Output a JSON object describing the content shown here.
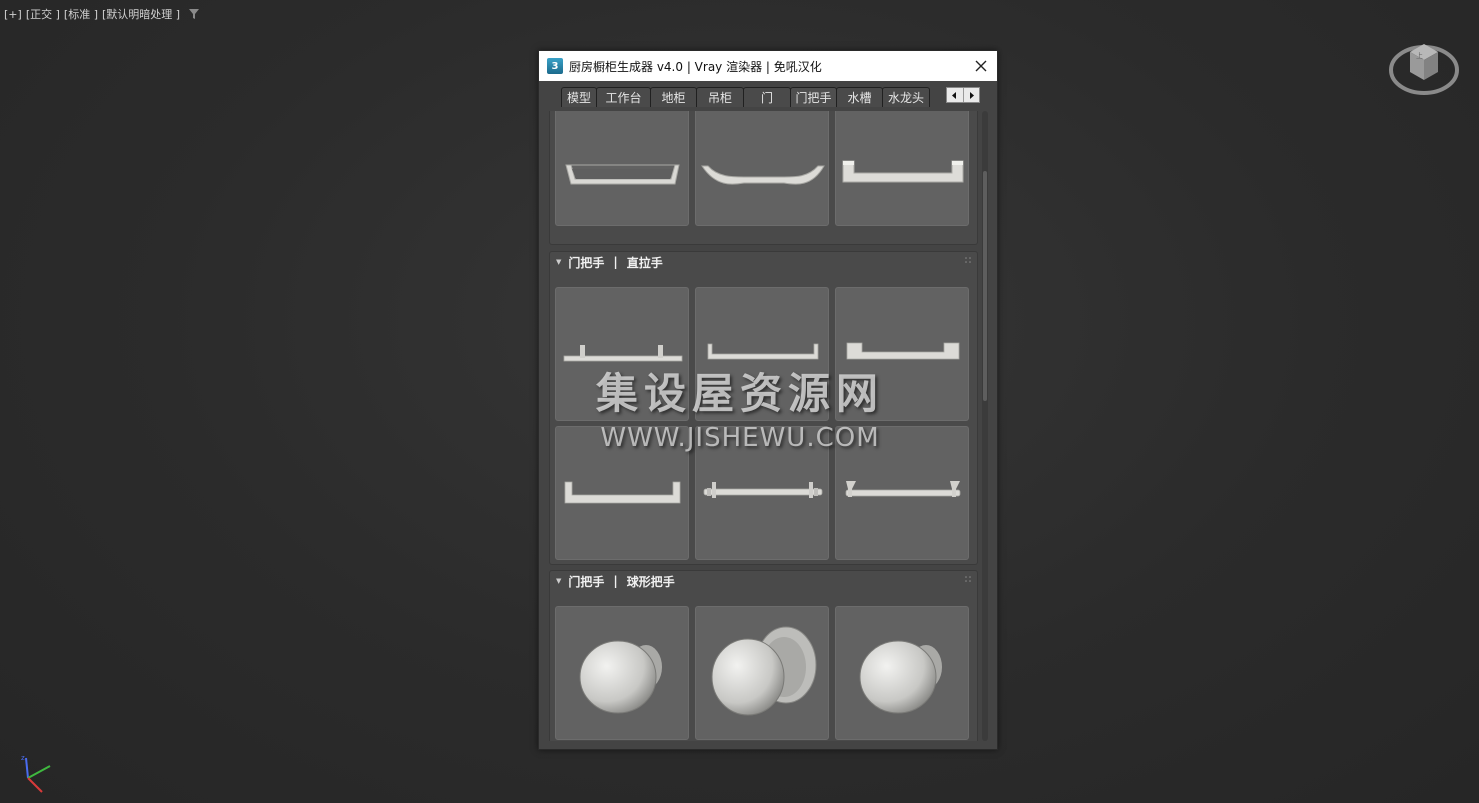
{
  "viewport": {
    "label_plus": "[+]",
    "label_view": "[正交 ]",
    "label_shading": "[标准 ]",
    "label_lighting": "[默认明暗处理 ]"
  },
  "dialog": {
    "icon_text": "3",
    "title": "厨房橱柜生成器 v4.0 | Vray 渲染器 | 免吼汉化",
    "tabs": [
      {
        "label": "模型"
      },
      {
        "label": "工作台"
      },
      {
        "label": "地柜"
      },
      {
        "label": "吊柜"
      },
      {
        "label": "门"
      },
      {
        "label": "门把手"
      },
      {
        "label": "水槽"
      },
      {
        "label": "水龙头"
      }
    ],
    "active_tab": "门把手",
    "sections": [
      {
        "category": "门把手",
        "subcategory": "直拉手"
      },
      {
        "category": "门把手",
        "subcategory": "球形把手"
      }
    ],
    "separator": "|"
  },
  "watermark": {
    "main": "集设屋资源网",
    "sub": "WWW.JISHEWU.COM"
  },
  "colors": {
    "handle_metal": "#d8d8d5",
    "thumb_bg": "#626262",
    "panel_bg": "#4a4a4a",
    "titlebar_bg": "#ffffff"
  }
}
